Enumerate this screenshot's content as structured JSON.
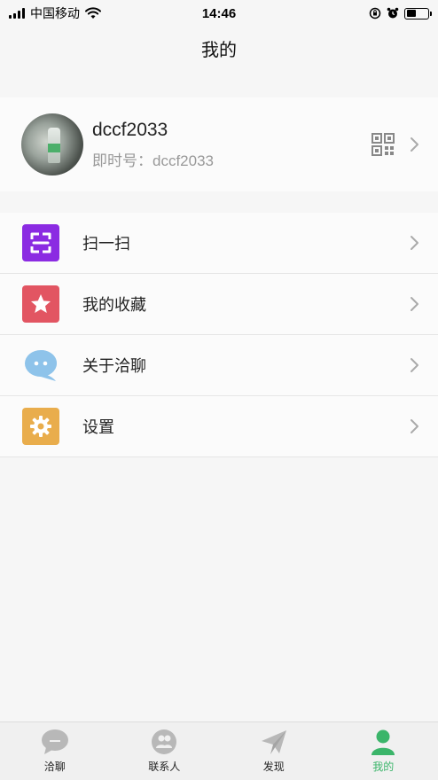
{
  "status_bar": {
    "carrier": "中国移动",
    "time": "14:46",
    "battery_level": 0.45
  },
  "nav": {
    "title": "我的"
  },
  "profile": {
    "username": "dccf2033",
    "account_line": "即时号：dccf2033"
  },
  "menu": [
    {
      "label": "扫一扫",
      "icon": "scan-icon",
      "color": "#8b2be2"
    },
    {
      "label": "我的收藏",
      "icon": "star-icon",
      "color": "#e25562"
    },
    {
      "label": "关于洽聊",
      "icon": "chat-bubble-icon",
      "color": "#8ec3ea"
    },
    {
      "label": "设置",
      "icon": "gear-icon",
      "color": "#e9ad4c"
    }
  ],
  "tabbar": {
    "tabs": [
      {
        "label": "洽聊",
        "icon": "chat-icon"
      },
      {
        "label": "联系人",
        "icon": "contacts-icon"
      },
      {
        "label": "发现",
        "icon": "paper-plane-icon"
      },
      {
        "label": "我的",
        "icon": "person-icon"
      }
    ],
    "active_index": 3,
    "active_color": "#3bb56a"
  }
}
